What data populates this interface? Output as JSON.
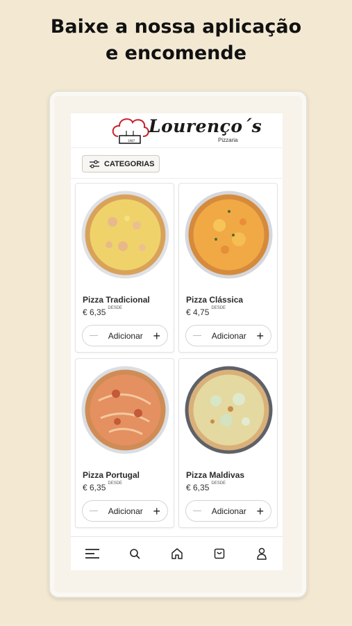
{
  "headline": {
    "line1": "Baixe a nossa aplicação",
    "line2": "e encomende"
  },
  "logo": {
    "name": "Lourenço´s",
    "subtitle": "Pizzaria",
    "hat_text": "1987"
  },
  "categories_button": {
    "label": "CATEGORIAS",
    "icon": "sliders-icon"
  },
  "products": [
    {
      "name": "Pizza Tradicional",
      "price": "€ 6,35",
      "price_note": "DESDE",
      "add_label": "Adicionar"
    },
    {
      "name": "Pizza Clássica",
      "price": "€ 4,75",
      "price_note": "DESDE",
      "add_label": "Adicionar"
    },
    {
      "name": "Pizza Portugal",
      "price": "€ 6,35",
      "price_note": "DESDE",
      "add_label": "Adicionar"
    },
    {
      "name": "Pizza Maldivas",
      "price": "€ 6,35",
      "price_note": "DESDE",
      "add_label": "Adicionar"
    }
  ],
  "bottom_nav": [
    "menu-icon",
    "search-icon",
    "home-icon",
    "orders-icon",
    "user-icon"
  ],
  "colors": {
    "background": "#f3e9d3",
    "logo_accent": "#c8202a"
  }
}
